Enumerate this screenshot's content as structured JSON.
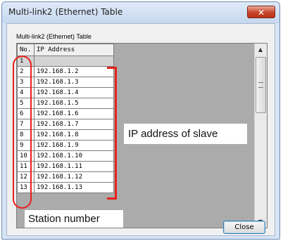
{
  "window": {
    "title": "Multi-link2 (Ethernet) Table",
    "close_glyph": "✕"
  },
  "dialog": {
    "group_label": "Multi-link2 (Ethernet) Table",
    "close_button_label": "Close"
  },
  "table": {
    "columns": [
      "No.",
      "IP Address"
    ],
    "rows": [
      {
        "no": "1",
        "ip": ""
      },
      {
        "no": "2",
        "ip": "192.168.1.2"
      },
      {
        "no": "3",
        "ip": "192.168.1.3"
      },
      {
        "no": "4",
        "ip": "192.168.1.4"
      },
      {
        "no": "5",
        "ip": "192.168.1.5"
      },
      {
        "no": "6",
        "ip": "192.168.1.6"
      },
      {
        "no": "7",
        "ip": "192.168.1.7"
      },
      {
        "no": "8",
        "ip": "192.168.1.8"
      },
      {
        "no": "9",
        "ip": "192.168.1.9"
      },
      {
        "no": "10",
        "ip": "192.168.1.10"
      },
      {
        "no": "11",
        "ip": "192.168.1.11"
      },
      {
        "no": "12",
        "ip": "192.168.1.12"
      },
      {
        "no": "13",
        "ip": "192.168.1.13"
      }
    ]
  },
  "scrollbar": {
    "up_glyph": "▲",
    "down_glyph": "▼"
  },
  "annotations": {
    "ip_label": "IP address of slave",
    "station_label": "Station number",
    "color": "#e8201a"
  }
}
